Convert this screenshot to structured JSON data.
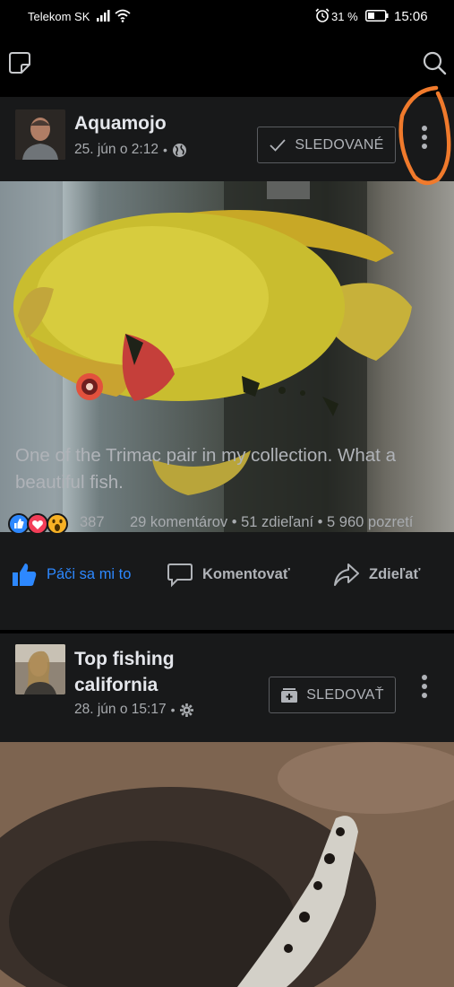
{
  "status_bar": {
    "carrier": "Telekom SK",
    "battery_percent": "31 %",
    "time": "15:06",
    "icons": [
      "signal-icon",
      "wifi-icon",
      "alarm-icon",
      "battery-icon"
    ]
  },
  "app_bar": {
    "left_icon": "sticker-icon",
    "right_icon": "search-icon"
  },
  "posts": [
    {
      "author": "Aquamojo",
      "date": "25. jún o 2:12",
      "separator": "•",
      "privacy_icon": "globe-icon",
      "follow_label": "SLEDOVANÉ",
      "follow_icon": "checkmark-icon",
      "more_icon": "more-vertical-icon",
      "image": "yellow trimac cichlid fish in aquarium",
      "caption": "One of the Trimac pair in my collection. What a beautiful fish.",
      "reaction_icons": [
        "like-reaction-icon",
        "love-reaction-icon",
        "wow-reaction-icon"
      ],
      "reaction_count": "387",
      "comments": "29 komentárov",
      "shares": "51 zdieľaní",
      "views": "5 960 pozretí",
      "stats_separator": "•",
      "actions": {
        "like": "Páči sa mi to",
        "comment": "Komentovať",
        "share": "Zdieľať"
      }
    },
    {
      "author": "Top fishing california",
      "date": "28. jún o 15:17",
      "separator": "•",
      "privacy_icon": "settings-gear-icon",
      "follow_label": "SLEDOVAŤ",
      "follow_icon": "add-follow-icon",
      "more_icon": "more-vertical-icon",
      "image": "aerial view of dark fish school near large white fish"
    }
  ],
  "colors": {
    "background": "#000000",
    "card": "#18191a",
    "accent": "#2d88ff",
    "annotation": "#f07a2c"
  }
}
